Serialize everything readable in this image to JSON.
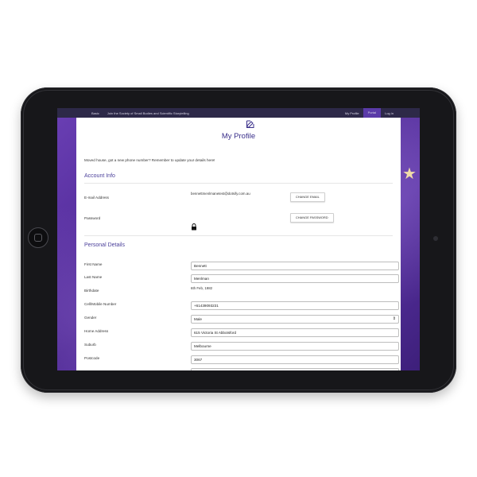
{
  "nav": {
    "items": [
      "Basic",
      "Join the Society of Small Bodies and Scientific Storytelling"
    ],
    "right_items": [
      "My Profile",
      "Portal",
      "Log in"
    ],
    "active": "Portal"
  },
  "profile": {
    "title": "My Profile",
    "intro": "Moved house, got a new phone number? Remember to update your details here!",
    "account": {
      "heading": "Account Info",
      "email_label": "E-mail Address",
      "email_value": "bennettmenlmanetest@dotsify.com.au",
      "change_email": "CHANGE EMAIL",
      "password_label": "Password",
      "change_password": "CHANGE PASSWORD"
    },
    "personal": {
      "heading": "Personal Details",
      "first_name_label": "First Name",
      "first_name_value": "Bennett",
      "last_name_label": "Last Name",
      "last_name_value": "Menlman",
      "birthdate_label": "Birthdate",
      "birthdate_value": "6th Feb, 1982",
      "mobile_label": "Cell/Mobile Number",
      "mobile_value": "+61439093231",
      "gender_label": "Gender",
      "gender_value": "Male",
      "address_label": "Home Address",
      "address_value": "615 Victoria St Abbotsford",
      "suburb_label": "Suburb",
      "suburb_value": "Melbourne",
      "postcode_label": "Postcode",
      "postcode_value": "3067"
    }
  },
  "colors": {
    "accent": "#3a2f8a",
    "nav_bg": "#2d2948",
    "nav_active": "#5a3aa8",
    "background_purple": "#4a2590"
  }
}
